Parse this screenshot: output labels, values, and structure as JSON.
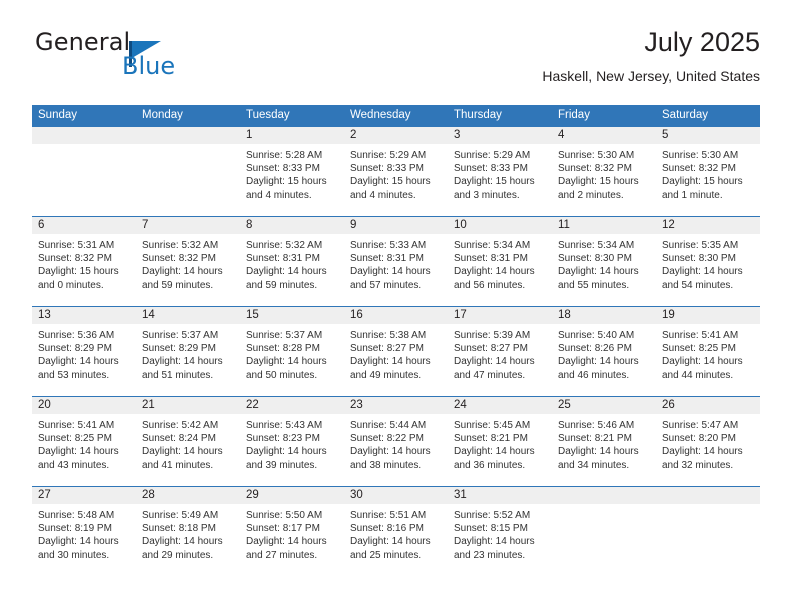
{
  "brand": {
    "name_dark": "General",
    "name_blue": "Blue",
    "accent_color": "#1b75bb"
  },
  "header": {
    "title": "July 2025",
    "location": "Haskell, New Jersey, United States",
    "header_bg": "#3076b8",
    "daynum_band_bg": "#efefef"
  },
  "weekday_headers": [
    "Sunday",
    "Monday",
    "Tuesday",
    "Wednesday",
    "Thursday",
    "Friday",
    "Saturday"
  ],
  "weeks": [
    [
      {
        "day": "",
        "sunrise": "",
        "sunset": "",
        "daylight": "",
        "empty": true
      },
      {
        "day": "",
        "sunrise": "",
        "sunset": "",
        "daylight": "",
        "empty": true
      },
      {
        "day": "1",
        "sunrise": "Sunrise: 5:28 AM",
        "sunset": "Sunset: 8:33 PM",
        "daylight": "Daylight: 15 hours and 4 minutes."
      },
      {
        "day": "2",
        "sunrise": "Sunrise: 5:29 AM",
        "sunset": "Sunset: 8:33 PM",
        "daylight": "Daylight: 15 hours and 4 minutes."
      },
      {
        "day": "3",
        "sunrise": "Sunrise: 5:29 AM",
        "sunset": "Sunset: 8:33 PM",
        "daylight": "Daylight: 15 hours and 3 minutes."
      },
      {
        "day": "4",
        "sunrise": "Sunrise: 5:30 AM",
        "sunset": "Sunset: 8:32 PM",
        "daylight": "Daylight: 15 hours and 2 minutes."
      },
      {
        "day": "5",
        "sunrise": "Sunrise: 5:30 AM",
        "sunset": "Sunset: 8:32 PM",
        "daylight": "Daylight: 15 hours and 1 minute."
      }
    ],
    [
      {
        "day": "6",
        "sunrise": "Sunrise: 5:31 AM",
        "sunset": "Sunset: 8:32 PM",
        "daylight": "Daylight: 15 hours and 0 minutes."
      },
      {
        "day": "7",
        "sunrise": "Sunrise: 5:32 AM",
        "sunset": "Sunset: 8:32 PM",
        "daylight": "Daylight: 14 hours and 59 minutes."
      },
      {
        "day": "8",
        "sunrise": "Sunrise: 5:32 AM",
        "sunset": "Sunset: 8:31 PM",
        "daylight": "Daylight: 14 hours and 59 minutes."
      },
      {
        "day": "9",
        "sunrise": "Sunrise: 5:33 AM",
        "sunset": "Sunset: 8:31 PM",
        "daylight": "Daylight: 14 hours and 57 minutes."
      },
      {
        "day": "10",
        "sunrise": "Sunrise: 5:34 AM",
        "sunset": "Sunset: 8:31 PM",
        "daylight": "Daylight: 14 hours and 56 minutes."
      },
      {
        "day": "11",
        "sunrise": "Sunrise: 5:34 AM",
        "sunset": "Sunset: 8:30 PM",
        "daylight": "Daylight: 14 hours and 55 minutes."
      },
      {
        "day": "12",
        "sunrise": "Sunrise: 5:35 AM",
        "sunset": "Sunset: 8:30 PM",
        "daylight": "Daylight: 14 hours and 54 minutes."
      }
    ],
    [
      {
        "day": "13",
        "sunrise": "Sunrise: 5:36 AM",
        "sunset": "Sunset: 8:29 PM",
        "daylight": "Daylight: 14 hours and 53 minutes."
      },
      {
        "day": "14",
        "sunrise": "Sunrise: 5:37 AM",
        "sunset": "Sunset: 8:29 PM",
        "daylight": "Daylight: 14 hours and 51 minutes."
      },
      {
        "day": "15",
        "sunrise": "Sunrise: 5:37 AM",
        "sunset": "Sunset: 8:28 PM",
        "daylight": "Daylight: 14 hours and 50 minutes."
      },
      {
        "day": "16",
        "sunrise": "Sunrise: 5:38 AM",
        "sunset": "Sunset: 8:27 PM",
        "daylight": "Daylight: 14 hours and 49 minutes."
      },
      {
        "day": "17",
        "sunrise": "Sunrise: 5:39 AM",
        "sunset": "Sunset: 8:27 PM",
        "daylight": "Daylight: 14 hours and 47 minutes."
      },
      {
        "day": "18",
        "sunrise": "Sunrise: 5:40 AM",
        "sunset": "Sunset: 8:26 PM",
        "daylight": "Daylight: 14 hours and 46 minutes."
      },
      {
        "day": "19",
        "sunrise": "Sunrise: 5:41 AM",
        "sunset": "Sunset: 8:25 PM",
        "daylight": "Daylight: 14 hours and 44 minutes."
      }
    ],
    [
      {
        "day": "20",
        "sunrise": "Sunrise: 5:41 AM",
        "sunset": "Sunset: 8:25 PM",
        "daylight": "Daylight: 14 hours and 43 minutes."
      },
      {
        "day": "21",
        "sunrise": "Sunrise: 5:42 AM",
        "sunset": "Sunset: 8:24 PM",
        "daylight": "Daylight: 14 hours and 41 minutes."
      },
      {
        "day": "22",
        "sunrise": "Sunrise: 5:43 AM",
        "sunset": "Sunset: 8:23 PM",
        "daylight": "Daylight: 14 hours and 39 minutes."
      },
      {
        "day": "23",
        "sunrise": "Sunrise: 5:44 AM",
        "sunset": "Sunset: 8:22 PM",
        "daylight": "Daylight: 14 hours and 38 minutes."
      },
      {
        "day": "24",
        "sunrise": "Sunrise: 5:45 AM",
        "sunset": "Sunset: 8:21 PM",
        "daylight": "Daylight: 14 hours and 36 minutes."
      },
      {
        "day": "25",
        "sunrise": "Sunrise: 5:46 AM",
        "sunset": "Sunset: 8:21 PM",
        "daylight": "Daylight: 14 hours and 34 minutes."
      },
      {
        "day": "26",
        "sunrise": "Sunrise: 5:47 AM",
        "sunset": "Sunset: 8:20 PM",
        "daylight": "Daylight: 14 hours and 32 minutes."
      }
    ],
    [
      {
        "day": "27",
        "sunrise": "Sunrise: 5:48 AM",
        "sunset": "Sunset: 8:19 PM",
        "daylight": "Daylight: 14 hours and 30 minutes."
      },
      {
        "day": "28",
        "sunrise": "Sunrise: 5:49 AM",
        "sunset": "Sunset: 8:18 PM",
        "daylight": "Daylight: 14 hours and 29 minutes."
      },
      {
        "day": "29",
        "sunrise": "Sunrise: 5:50 AM",
        "sunset": "Sunset: 8:17 PM",
        "daylight": "Daylight: 14 hours and 27 minutes."
      },
      {
        "day": "30",
        "sunrise": "Sunrise: 5:51 AM",
        "sunset": "Sunset: 8:16 PM",
        "daylight": "Daylight: 14 hours and 25 minutes."
      },
      {
        "day": "31",
        "sunrise": "Sunrise: 5:52 AM",
        "sunset": "Sunset: 8:15 PM",
        "daylight": "Daylight: 14 hours and 23 minutes."
      },
      {
        "day": "",
        "sunrise": "",
        "sunset": "",
        "daylight": "",
        "empty": true
      },
      {
        "day": "",
        "sunrise": "",
        "sunset": "",
        "daylight": "",
        "empty": true
      }
    ]
  ]
}
